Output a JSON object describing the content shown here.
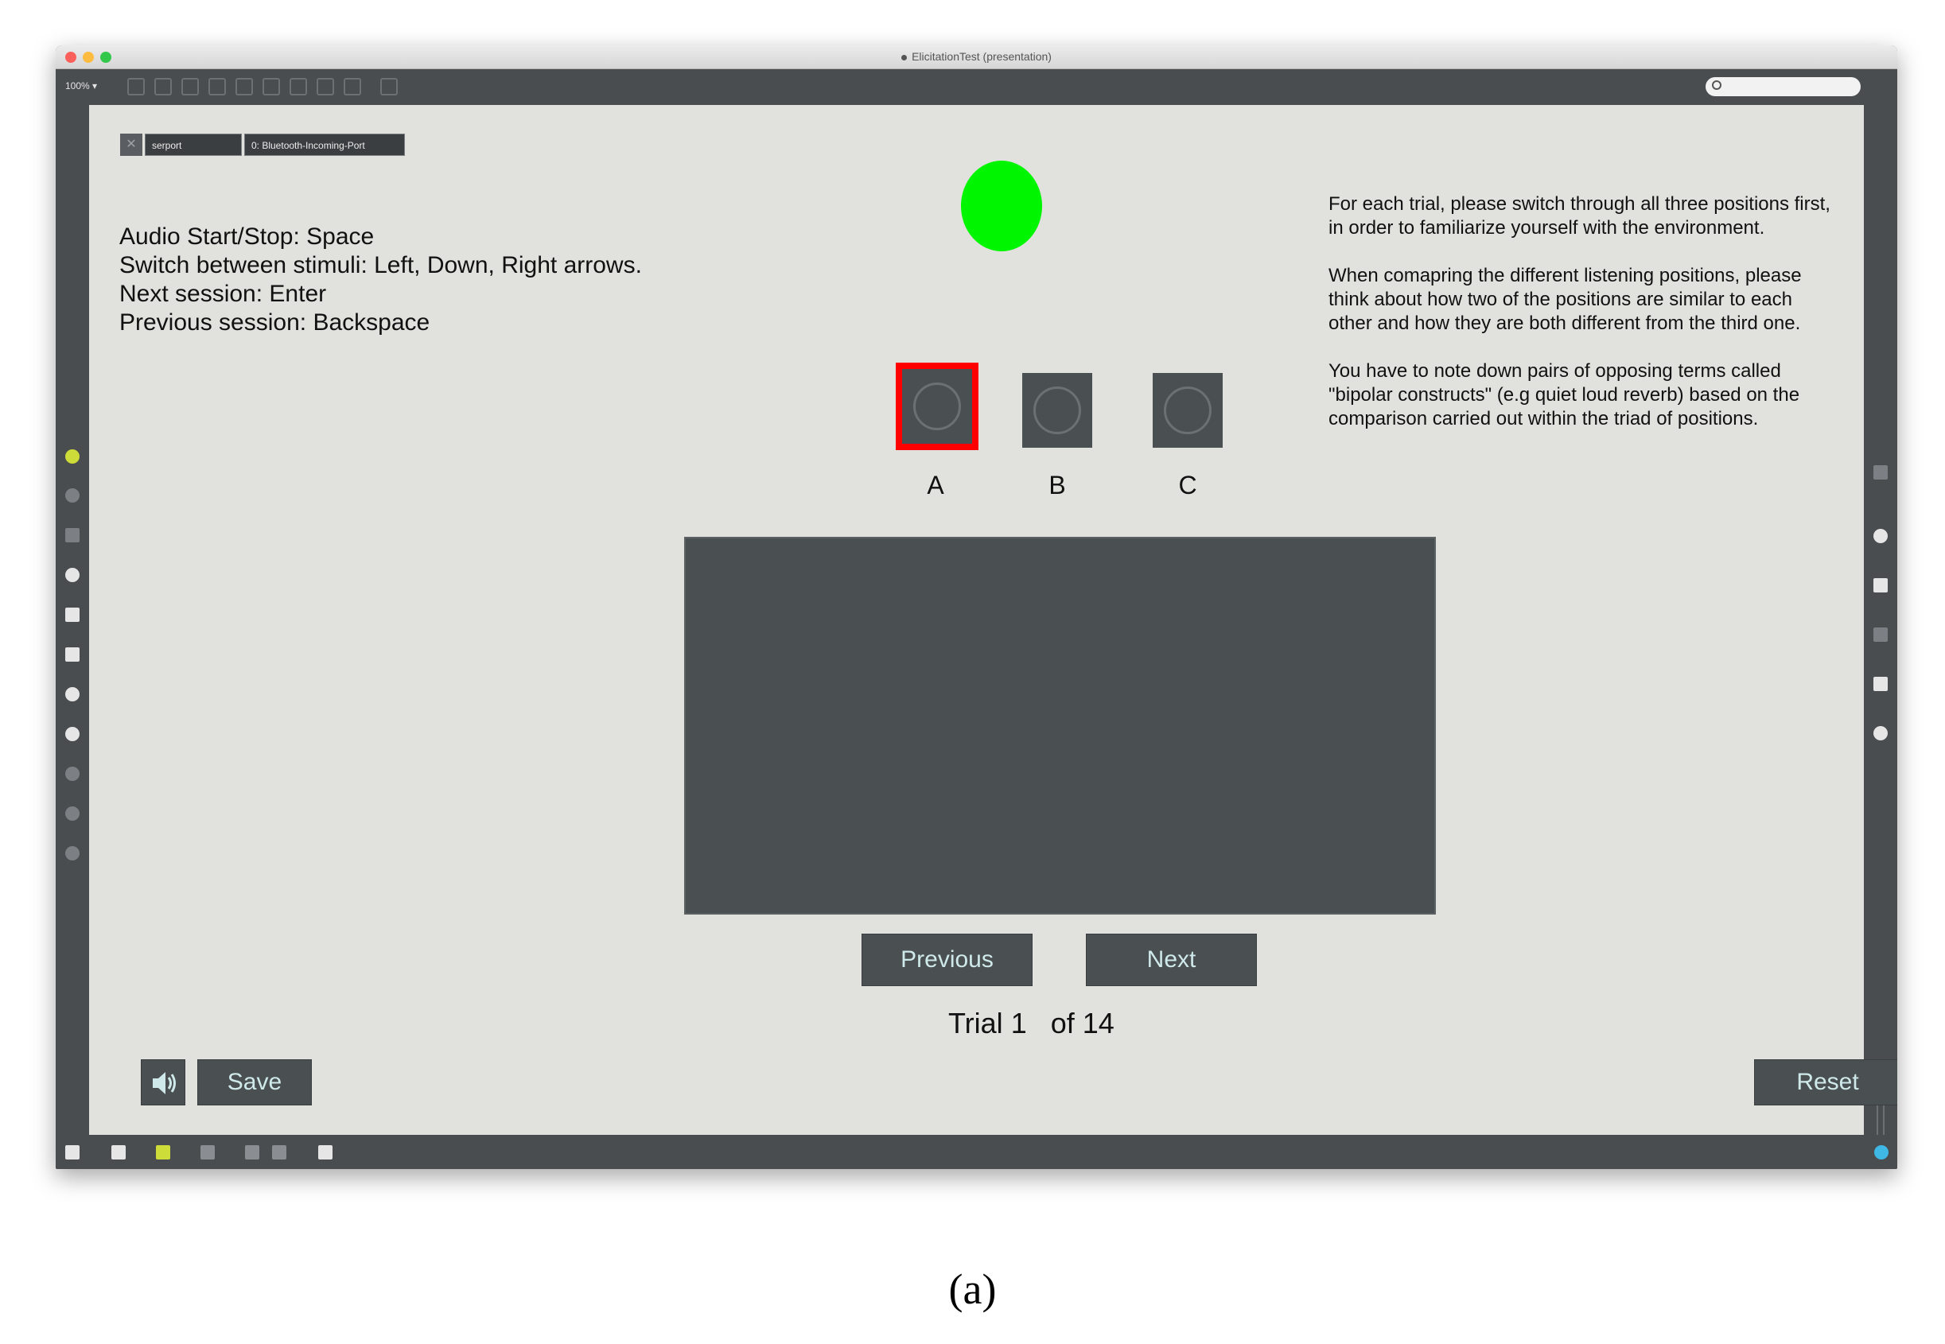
{
  "window": {
    "title": "ElicitationTest (presentation)"
  },
  "toolbar": {
    "zoom": "100%",
    "search_placeholder": ""
  },
  "serial": {
    "port_label": "serport",
    "device_label": "0: Bluetooth-Incoming-Port"
  },
  "instructions": {
    "lines": [
      "Audio Start/Stop: Space",
      "Switch between stimuli: Left, Down, Right arrows.",
      "Next session: Enter",
      "Previous session: Backspace"
    ]
  },
  "help": {
    "paragraphs": [
      "For each trial, please switch through all three positions first, in order to familiarize yourself with the environment.",
      "When comapring the different listening positions, please think about how two of the positions are similar to each other and how they are both different from the third one.",
      "You have to note down pairs of opposing terms called \"bipolar constructs\" (e.g quiet loud reverb) based on the comparison carried out within the triad of positions."
    ]
  },
  "stimuli": [
    {
      "label": "A",
      "selected": true
    },
    {
      "label": "B",
      "selected": false
    },
    {
      "label": "C",
      "selected": false
    }
  ],
  "buttons": {
    "previous": "Previous",
    "next": "Next",
    "save": "Save",
    "reset": "Reset"
  },
  "trial": {
    "prefix": "Trial",
    "current": "1",
    "of": "of",
    "total": "14"
  },
  "colors": {
    "indicator": "#00f500",
    "selected_outline": "#ff0000",
    "canvas_bg": "#e1e1dd",
    "button_bg": "#4a4f51"
  },
  "caption": "(a)"
}
